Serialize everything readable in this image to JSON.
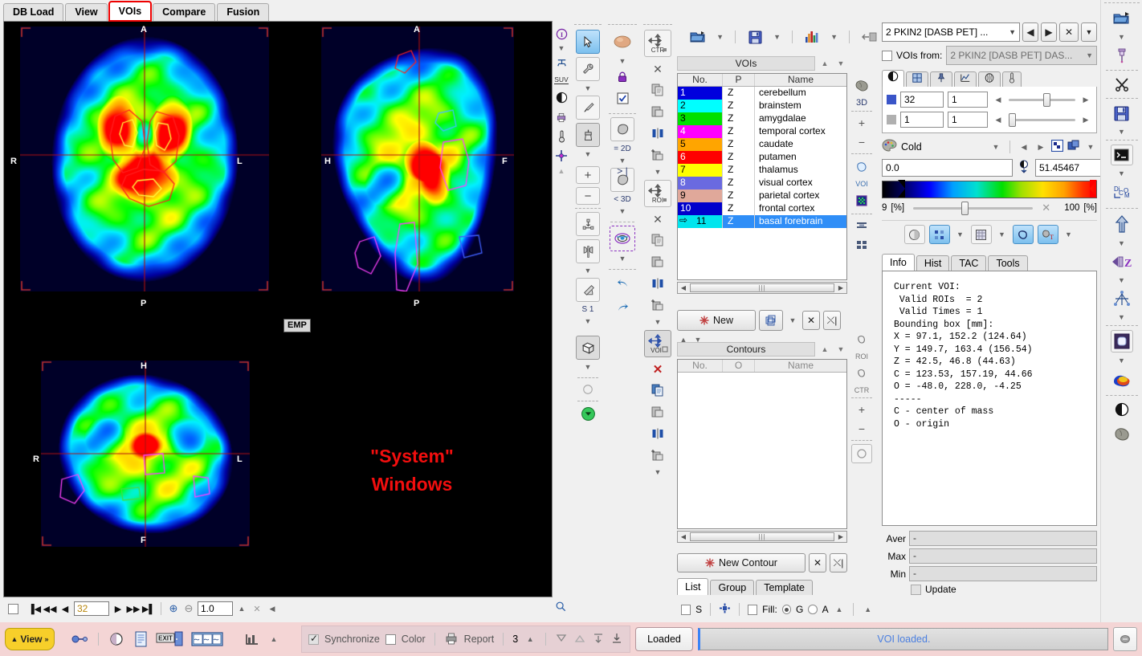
{
  "tabs": [
    {
      "label": "DB Load",
      "active": false
    },
    {
      "label": "View",
      "active": false
    },
    {
      "label": "VOIs",
      "active": true,
      "highlighted": true
    },
    {
      "label": "Compare",
      "active": false
    },
    {
      "label": "Fusion",
      "active": false
    }
  ],
  "viewport": {
    "overlay_text_line1": "\"System\"",
    "overlay_text_line2": "Windows",
    "emp_badge": "EMP",
    "orientations": {
      "transaxial": {
        "top": "A",
        "bottom": "P",
        "left": "R",
        "right": "L"
      },
      "sagittal": {
        "top": "A",
        "bottom": "P",
        "left": "H",
        "right": "F"
      },
      "coronal": {
        "top": "H",
        "bottom": "F",
        "left": "R",
        "right": "L"
      }
    }
  },
  "viewport_controls": {
    "slice_value": "32",
    "zoom_value": "1.0",
    "icons": [
      "first-slice-icon",
      "prev-fast-icon",
      "prev-icon",
      "next-icon",
      "next-fast-icon",
      "last-slice-icon",
      "zoom-in-icon",
      "zoom-out-icon"
    ]
  },
  "left_icon_rail": [
    "info-icon",
    "chevron-down-icon",
    "ruler-icon",
    "suv-icon",
    "contrast-icon",
    "print-icon",
    "thermometer-icon",
    "crosshair-icon",
    "chevron-up-icon"
  ],
  "tool_column_1": [
    "arrow-select-icon",
    "wrench-settings-icon",
    "chevron-down-icon",
    "scalpel-icon",
    "brush-icon",
    "chevron-down-icon",
    "plus-icon",
    "minus-icon",
    "interpolate-icon",
    "axe-split-icon",
    "chevron-down-icon",
    "eraser-icon",
    "s1-label",
    "chevron-down-icon",
    "cube-3d-icon",
    "chevron-down-icon",
    "circle-outline-icon",
    "green-down-icon"
  ],
  "tool_column_1_label": "S 1",
  "tool_column_2": [
    "sphere-icon",
    "chevron-down-icon",
    "lock-icon",
    "checkbox-icon",
    "blob-2d-icon",
    "greater-bar-icon",
    "chevron-down-icon",
    "blob-3d-icon",
    "chevron-down-icon",
    "target-rings-icon",
    "chevron-down-icon",
    "undo-icon",
    "redo-icon"
  ],
  "tool_column_2_labels": {
    "eq2d": "= 2D",
    "lt3d": "< 3D",
    "gtbar": "> |"
  },
  "tool_column_3": [
    "move-ctr-icon",
    "close-x-icon",
    "copy-icon",
    "paste-icon",
    "mirror-icon",
    "add-paste-icon",
    "chevron-down-icon",
    "move-roi-icon",
    "close-x-icon",
    "copy-icon",
    "paste-icon",
    "mirror-icon",
    "add-paste-icon",
    "chevron-down-icon",
    "move-voi-icon",
    "delete-red-x-icon",
    "copy-icon",
    "paste-icon",
    "mirror-icon",
    "add-paste-icon",
    "chevron-down-icon"
  ],
  "tool_column_3_labels": {
    "ctr": "CTR",
    "roi": "ROI",
    "voi": "VOI"
  },
  "top_toolbar": {
    "icons": [
      "open-folder-icon",
      "chevron-down-icon",
      "save-disk-icon",
      "chevron-down-icon",
      "statistics-chart-icon",
      "chevron-down-icon",
      "transfer-icon"
    ]
  },
  "voi_panel": {
    "title": "VOIs",
    "columns": [
      "No.",
      "P",
      "Name"
    ],
    "rows": [
      {
        "no": "1",
        "p": "Z",
        "name": "cerebellum",
        "color": "#0000dd"
      },
      {
        "no": "2",
        "p": "Z",
        "name": "brainstem",
        "color": "#00ffff"
      },
      {
        "no": "3",
        "p": "Z",
        "name": "amygdalae",
        "color": "#00e000"
      },
      {
        "no": "4",
        "p": "Z",
        "name": "temporal cortex",
        "color": "#ff00ff"
      },
      {
        "no": "5",
        "p": "Z",
        "name": "caudate",
        "color": "#ffa500"
      },
      {
        "no": "6",
        "p": "Z",
        "name": "putamen",
        "color": "#ff0000"
      },
      {
        "no": "7",
        "p": "Z",
        "name": "thalamus",
        "color": "#ffff00"
      },
      {
        "no": "8",
        "p": "Z",
        "name": "visual cortex",
        "color": "#6a6ae0"
      },
      {
        "no": "9",
        "p": "Z",
        "name": "parietal cortex",
        "color": "#e0a89a"
      },
      {
        "no": "10",
        "p": "Z",
        "name": "frontal cortex",
        "color": "#0000cc"
      },
      {
        "no": "11",
        "p": "Z",
        "name": "basal forebrain",
        "color": "#00e5ee",
        "selected": true
      }
    ],
    "new_button": "New",
    "buttons": [
      "copy-voi-icon",
      "chevron-down-icon",
      "delete-voi-icon",
      "delete-all-voi-icon"
    ]
  },
  "contours_panel": {
    "title": "Contours",
    "columns": [
      "No.",
      "O",
      "Name"
    ],
    "rows": [],
    "new_button": "New Contour",
    "buttons": [
      "delete-contour-icon",
      "delete-all-contours-icon"
    ]
  },
  "bottom_tabs": [
    {
      "label": "List",
      "active": true
    },
    {
      "label": "Group",
      "active": false
    },
    {
      "label": "Template",
      "active": false
    }
  ],
  "bottom_options": {
    "s_checkbox_label": "S",
    "s_checked": false,
    "marker_icon": "marker-icon",
    "fill_checkbox_checked": false,
    "fill_label": "Fill:",
    "fill_g_label": "G",
    "fill_a_label": "A",
    "fill_selected": "G"
  },
  "right_panel": {
    "dataset_combo": "2 PKIN2 [DASB PET] ...",
    "dataset_nav_icons": [
      "prev-dataset-icon",
      "next-dataset-icon",
      "close-dataset-icon",
      "chevron-down-icon"
    ],
    "vois_from_label": "VOIs from:",
    "vois_from_checked": false,
    "vois_from_value": "2 PKIN2 [DASB PET] DAS...",
    "subtabs": [
      "contrast-icon",
      "layout-grid-icon",
      "pin-figure-icon",
      "plot-curve-icon",
      "brain-atlas-icon",
      "thermometer-icon"
    ],
    "active_subtab": 0,
    "slice_field_1": "32",
    "slice_field_2": "1",
    "time_field_1": "1",
    "time_field_2": "1",
    "colortable_name": "Cold",
    "colortable_icon": "palette-icon",
    "min_value": "0.0",
    "max_value": "51.45467",
    "percent_min": "9",
    "percent_min_unit": "[%]",
    "percent_max": "100",
    "percent_max_unit": "[%]",
    "display_icons": [
      "alpha-blend-icon",
      "markers-icon",
      "chevron-down-icon",
      "grid-icon",
      "chevron-down-icon",
      "contour-outline-icon",
      "contour-text-icon",
      "chevron-down-icon"
    ]
  },
  "info_tabs": [
    {
      "label": "Info",
      "active": true
    },
    {
      "label": "Hist",
      "active": false
    },
    {
      "label": "TAC",
      "active": false
    },
    {
      "label": "Tools",
      "active": false
    }
  ],
  "info_text": "Current VOI:\n Valid ROIs  = 2\n Valid Times = 1\nBounding box [mm]:\nX = 97.1, 152.2 (124.64)\nY = 149.7, 163.4 (156.54)\nZ = 42.5, 46.8 (44.63)\nC = 123.53, 157.19, 44.66\nO = -48.0, 228.0, -4.25\n-----\nC - center of mass\nO - origin",
  "stats": {
    "aver_label": "Aver",
    "aver_value": "-",
    "max_label": "Max",
    "max_value": "-",
    "min_label": "Min",
    "min_value": "-",
    "update_label": "Update",
    "update_checked": false
  },
  "right_rail_3d": {
    "label_3d": "3D",
    "label_voi": "VOI",
    "label_roi": "ROI",
    "label_ctr": "CTR",
    "icons": [
      "brain-3d-icon",
      "plus-icon",
      "minus-icon",
      "voi-outline-icon",
      "colormap-icon",
      "align-icon",
      "split-icon"
    ]
  },
  "far_right_rail": [
    "open-project-icon",
    "chevron-down-icon",
    "pin-icon",
    "scissors-icon",
    "save-disk-icon",
    "chevron-down-icon",
    "terminal-icon",
    "chevron-down-icon",
    "dicom-icon",
    "upload-arrow-icon",
    "chevron-down-icon",
    "flip-z-icon",
    "chevron-down-icon",
    "registration-icon",
    "chevron-down-icon",
    "frame-icon",
    "chevron-down-icon",
    "colorball-icon",
    "contrast-icon",
    "brain-icon"
  ],
  "statusbar": {
    "view_button": "View",
    "left_icons": [
      "link-icon",
      "contrast-toggle-icon",
      "document-icon",
      "exit-icon",
      "layout-icon",
      "stats-icon",
      "chevron-up-icon"
    ],
    "synchronize_label": "Synchronize",
    "synchronize_checked": true,
    "color_label": "Color",
    "color_checked": false,
    "report_label": "Report",
    "report_icon": "printer-icon",
    "count_value": "3",
    "right_icons": [
      "down-tri-icon",
      "up-tri-icon",
      "top-align-icon",
      "bottom-align-icon"
    ],
    "loaded_label": "Loaded",
    "message": "VOI loaded.",
    "end_icon": "stop-icon"
  },
  "colors": {
    "accent_blue": "#2f8ef7",
    "status_pink": "#f4d5d5",
    "yellow_button": "#f7cf2a",
    "message_blue": "#4b7fe0",
    "highlight_red": "#ee0000"
  }
}
